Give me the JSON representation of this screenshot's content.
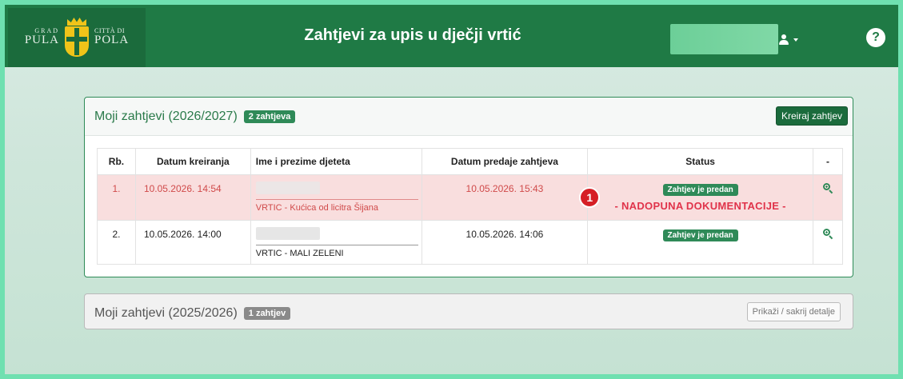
{
  "header": {
    "logo": {
      "left_small": "GRAD",
      "left_big": "PULA",
      "right_small": "CITTÀ DI",
      "right_big": "POLA"
    },
    "title": "Zahtjevi za upis u dječji vrtić",
    "user_icon": "user-icon",
    "help_label": "?"
  },
  "card_current": {
    "title": "Moji zahtjevi (2026/2027)",
    "badge": "2 zahtjeva",
    "create_button": "Kreiraj zahtjev",
    "columns": [
      "Rb.",
      "Datum kreiranja",
      "Ime i prezime djeteta",
      "Datum predaje zahtjeva",
      "Status",
      "-"
    ],
    "rows": [
      {
        "rb": "1.",
        "created": "10.05.2026. 14:54",
        "vrtic": "VRTIC - Kućica od licitra Šijana",
        "submitted": "10.05.2026. 15:43",
        "status": "Zahtjev je predan",
        "note": "- NADOPUNA DOKUMENTACIJE -",
        "marker": "1",
        "action_icon": "zoom-in-icon"
      },
      {
        "rb": "2.",
        "created": "10.05.2026. 14:00",
        "vrtic": "VRTIC - MALI ZELENI",
        "submitted": "10.05.2026. 14:06",
        "status": "Zahtjev je predan",
        "action_icon": "zoom-in-icon"
      }
    ]
  },
  "card_previous": {
    "title": "Moji zahtjevi (2025/2026)",
    "badge": "1 zahtjev",
    "toggle_button": "Prikaži / sakrij detalje"
  },
  "colors": {
    "brand_green": "#1f7a45",
    "highlight_row": "#f9dede",
    "alert_red": "#e0334a",
    "marker_red": "#d61f26"
  }
}
